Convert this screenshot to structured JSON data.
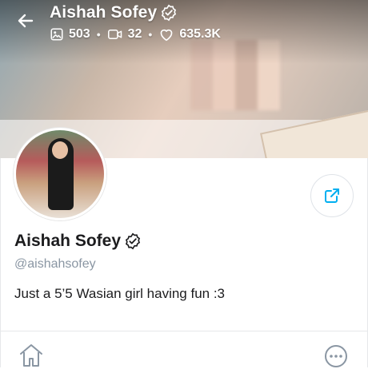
{
  "header": {
    "title": "Aishah Sofey",
    "stats": {
      "photos": "503",
      "videos": "32",
      "likes": "635.3K"
    }
  },
  "profile": {
    "name": "Aishah Sofey",
    "handle": "@aishahsofey",
    "bio": "Just a 5’5 Wasian girl having fun :3"
  },
  "icons": {
    "back": "arrow-left-icon",
    "verified": "verified-badge-icon",
    "photo": "image-icon",
    "video": "video-icon",
    "like": "heart-icon",
    "share": "share-icon",
    "home": "home-icon",
    "more": "more-dots-icon"
  },
  "colors": {
    "accent": "#00aff0",
    "text": "#1c1c1e",
    "muted": "#8a96a3"
  }
}
